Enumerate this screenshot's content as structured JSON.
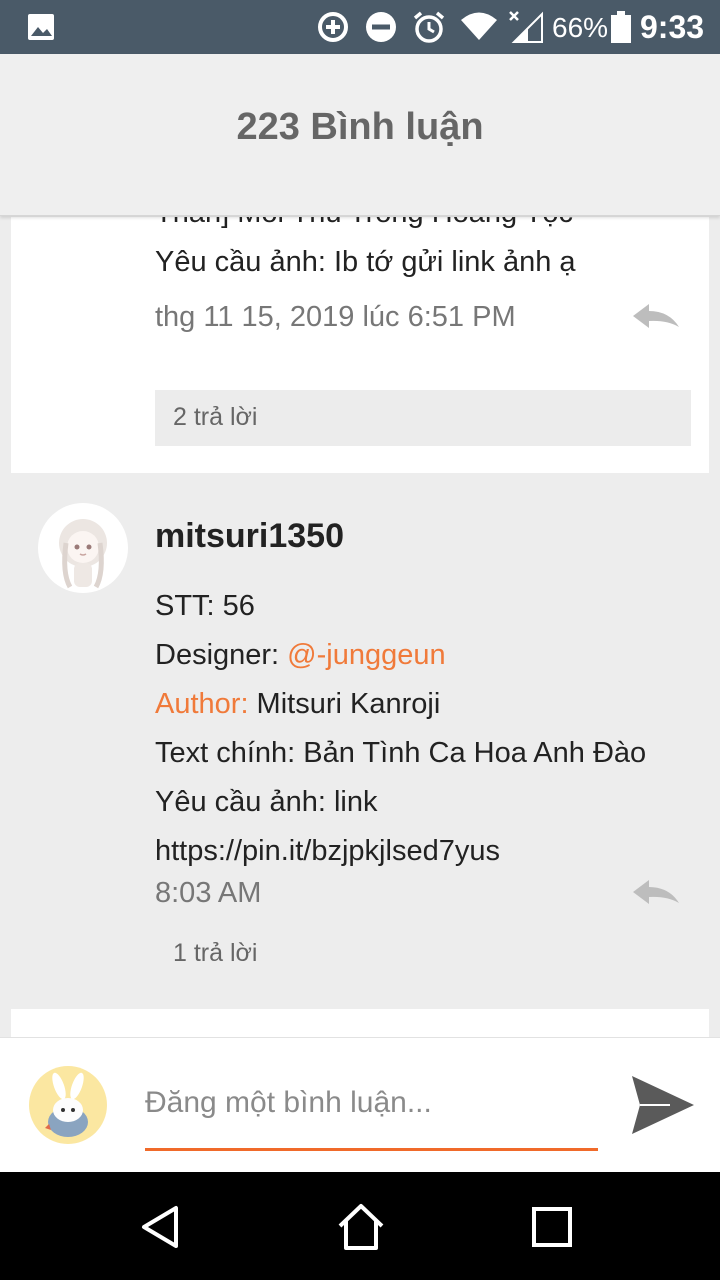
{
  "status_bar": {
    "battery_percent": "66%",
    "time": "9:33"
  },
  "header": {
    "title": "223 Bình luận"
  },
  "comments": [
    {
      "lines": [
        "Thần] Mối Thù Trong Hoàng Tộc",
        "Yêu cầu ảnh: Ib tớ gửi link ảnh ạ"
      ],
      "timestamp": "thg 11 15, 2019 lúc 6:51 PM",
      "replies_label": "2 trả lời"
    },
    {
      "username": "mitsuri1350",
      "stt": "STT: 56",
      "designer_label": "Designer: ",
      "designer_mention": "@-junggeun",
      "author_label": "Author:",
      "author_value": " Mitsuri Kanroji",
      "text_line": "Text chính: Bản Tình Ca Hoa Anh Đào",
      "request_line": "Yêu cầu ảnh: link",
      "link_line": "https://pin.it/bzjpkjlsed7yus",
      "timestamp": "8:03 AM",
      "replies_label": "1 trả lời"
    }
  ],
  "comment_input": {
    "placeholder": "Đăng một bình luận..."
  },
  "colors": {
    "accent": "#f07a3a",
    "status_bar": "#4a5a68",
    "underline": "#f06a2a"
  }
}
